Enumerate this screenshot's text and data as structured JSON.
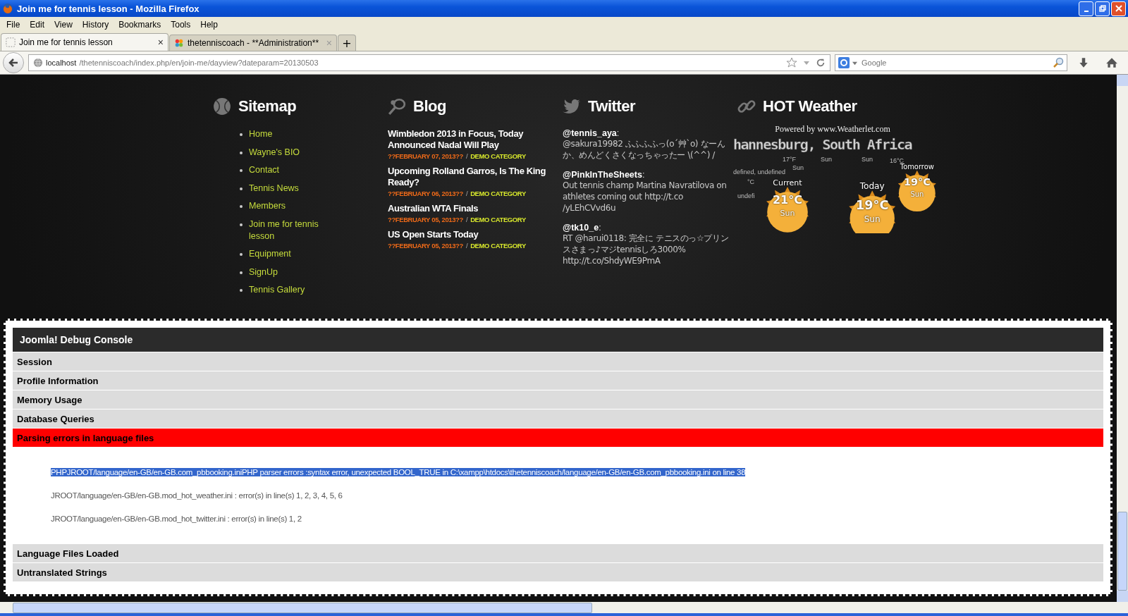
{
  "window": {
    "title": "Join me for tennis lesson - Mozilla Firefox"
  },
  "menu": [
    "File",
    "Edit",
    "View",
    "History",
    "Bookmarks",
    "Tools",
    "Help"
  ],
  "tabs": [
    {
      "label": "Join me for tennis lesson",
      "selected": true,
      "close": "×"
    },
    {
      "label": "thetenniscoach - **Administration**",
      "selected": false,
      "close": "×"
    }
  ],
  "new_tab": "+",
  "address_bar": {
    "host": "localhost",
    "path": "/thetenniscoach/index.php/en/join-me/dayview?dateparam=20130503"
  },
  "search": {
    "placeholder": "Google"
  },
  "sitemap": {
    "title": "Sitemap",
    "items": [
      "Home",
      "Wayne's BIO",
      "Contact",
      "Tennis News",
      "Members",
      "Join me for tennis lesson",
      "Equipment",
      "SignUp",
      "Tennis Gallery"
    ]
  },
  "blog": {
    "title": "Blog",
    "posts": [
      {
        "title": "Wimbledon 2013 in Focus, Today Announced Nadal Will Play",
        "date": "??**FEBRUARY** 07, 2013??",
        "separator": "/",
        "category": "DEMO CATEGORY"
      },
      {
        "title": "Upcoming Rolland Garros, Is The King Ready?",
        "date": "??**FEBRUARY** 06, 2013??",
        "separator": "/",
        "category": "DEMO CATEGORY"
      },
      {
        "title": "Australian WTA Finals",
        "date": "??**FEBRUARY** 05, 2013??",
        "separator": "/",
        "category": "DEMO CATEGORY"
      },
      {
        "title": "US Open Starts Today",
        "date": "??**FEBRUARY** 05, 2013??",
        "separator": "/",
        "category": "DEMO CATEGORY"
      }
    ]
  },
  "twitter": {
    "title": "Twitter",
    "tweets": [
      {
        "user": "@tennis_aya",
        "colon": ":",
        "text": "@sakura19982 ふふふふっ(o´艸`o) なーんか、めんどくさくなっちゃったー \\(^^) /"
      },
      {
        "user": "@PinkInTheSheets",
        "colon": ":",
        "text": "Out tennis champ Martina Navratilova on athletes coming out http://t.co /yLEhCVvd6u"
      },
      {
        "user": "@tk10_e",
        "colon": ":",
        "text": "RT @harui0118: 完全に テニスのっ☆プリンスさまっ♪マジtennisしろ3000% http://t.co/ShdyWE9PmA"
      }
    ]
  },
  "weather": {
    "title": "HOT Weather",
    "powered_by": "Powered by www.Weatherlet.com",
    "city": "hannesburg, South Africa",
    "forecasts": [
      {
        "label": "Current",
        "temp": "21°C",
        "condition": "Sun"
      },
      {
        "label": "Today",
        "temp": "19°C",
        "condition": "Sun"
      },
      {
        "label": "Tomorrow",
        "temp": "19°C",
        "condition": "Sun"
      }
    ],
    "fragments": [
      "defined, undefined",
      "°C",
      "undefi",
      "17°F",
      "Sun",
      "Sun",
      "Sun",
      "16°C"
    ]
  },
  "debug": {
    "title": "**Joomla! Debug Console**",
    "sections": [
      {
        "label": "**Session**",
        "expanded": false
      },
      {
        "label": "**Profile Information**",
        "expanded": false
      },
      {
        "label": "**Memory Usage**",
        "expanded": false
      },
      {
        "label": "**Database Queries**",
        "expanded": false
      },
      {
        "label": "**Parsing errors in language files**",
        "expanded": true,
        "errors": [
          {
            "text": "PHPJROOT/language/en-GB/en-GB.com_pbbooking.iniPHP parser errors :syntax error, unexpected BOOL_TRUE in C:\\xampp\\htdocs\\thetenniscoach/language/en-GB/en-GB.com_pbbooking.ini on line 38",
            "selected": true
          },
          {
            "text": "JROOT/language/en-GB/en-GB.mod_hot_weather.ini : error(s) in line(s) 1, 2, 3, 4, 5, 6",
            "selected": false
          },
          {
            "text": "JROOT/language/en-GB/en-GB.mod_hot_twitter.ini : error(s) in line(s) 1, 2",
            "selected": false
          }
        ]
      },
      {
        "label": "**Language Files Loaded**",
        "expanded": false
      },
      {
        "label": "**Untranslated Strings**",
        "expanded": false
      }
    ]
  }
}
